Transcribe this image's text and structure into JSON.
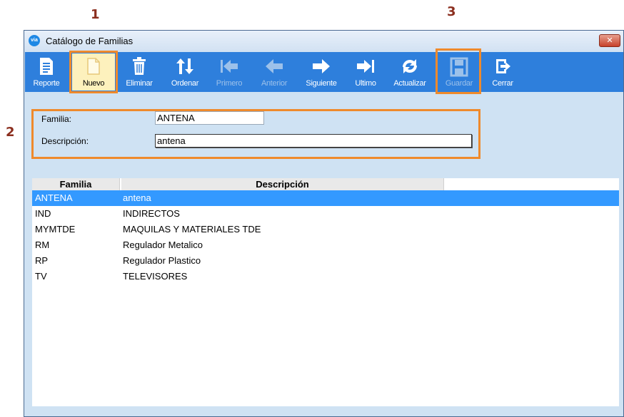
{
  "annotations": {
    "one": "1",
    "two": "2",
    "three": "3"
  },
  "window": {
    "title": "Catálogo de Familias",
    "app_icon_text": "via",
    "close_symbol": "✕"
  },
  "toolbar": {
    "reporte": "Reporte",
    "nuevo": "Nuevo",
    "eliminar": "Eliminar",
    "ordenar": "Ordenar",
    "primero": "Primero",
    "anterior": "Anterior",
    "siguiente": "Siguiente",
    "ultimo": "Ultimo",
    "actualizar": "Actualizar",
    "guardar": "Guardar",
    "cerrar": "Cerrar"
  },
  "form": {
    "familia_label": "Familia:",
    "familia_value": "ANTENA",
    "descripcion_label": "Descripción:",
    "descripcion_value": "antena"
  },
  "table": {
    "headers": [
      "Familia",
      "Descripción"
    ],
    "rows": [
      [
        "ANTENA",
        "antena"
      ],
      [
        "IND",
        "INDIRECTOS"
      ],
      [
        "MYMTDE",
        "MAQUILAS Y MATERIALES TDE"
      ],
      [
        "RM",
        "Regulador Metalico"
      ],
      [
        "RP",
        "Regulador Plastico"
      ],
      [
        "TV",
        "TELEVISORES"
      ]
    ],
    "selected_row": 0
  },
  "colors": {
    "toolbar": "#2e7fdc",
    "highlight": "#ef8a2c",
    "selection": "#3399ff",
    "panel": "#cfe2f3"
  }
}
